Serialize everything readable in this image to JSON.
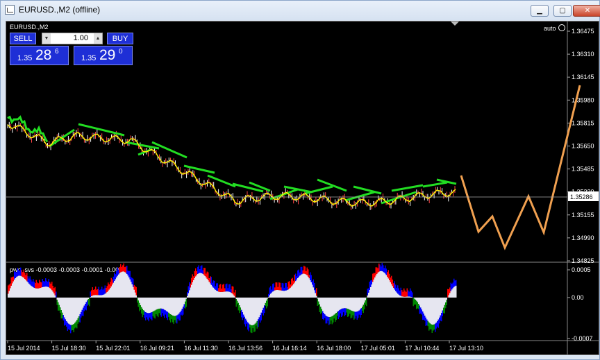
{
  "window": {
    "title": "EURUSD.,M2 (offline)",
    "minimize": "▁",
    "maximize": "▢",
    "close": "✕"
  },
  "chart": {
    "symbol_label": "EURUSD.,M2",
    "auto_label": "auto",
    "price_ticks": [
      "1.36475",
      "1.36310",
      "1.36145",
      "1.35980",
      "1.35815",
      "1.35650",
      "1.35485",
      "1.35320",
      "1.35155",
      "1.34990",
      "1.34825"
    ],
    "current_price": "1.35286",
    "indicator_label": "pwo_svs -0.0003 -0.0003 -0.0001 -0.0000",
    "indicator_ticks": [
      "0.0005",
      "0.00",
      "-0.0007"
    ],
    "time_ticks": [
      "15 Jul 2014",
      "15 Jul 18:30",
      "15 Jul 22:01",
      "16 Jul 09:21",
      "16 Jul 11:30",
      "16 Jul 13:56",
      "16 Jul 16:14",
      "16 Jul 18:00",
      "17 Jul 05:01",
      "17 Jul 10:44",
      "17 Jul 13:10"
    ],
    "colors": {
      "background": "#000000",
      "ma_green": "#22dd22",
      "ma_yellow": "#ffee00",
      "forecast": "#f0a050",
      "histo_red": "#ff0000",
      "histo_blue": "#0000ff",
      "histo_green": "#008800",
      "histo_white": "#e6e6f0"
    }
  },
  "trade": {
    "sell_label": "SELL",
    "buy_label": "BUY",
    "lot": "1.00",
    "sell_small": "1.35",
    "sell_big": "28",
    "sell_sup": "6",
    "buy_small": "1.35",
    "buy_big": "29",
    "buy_sup": "0"
  }
}
